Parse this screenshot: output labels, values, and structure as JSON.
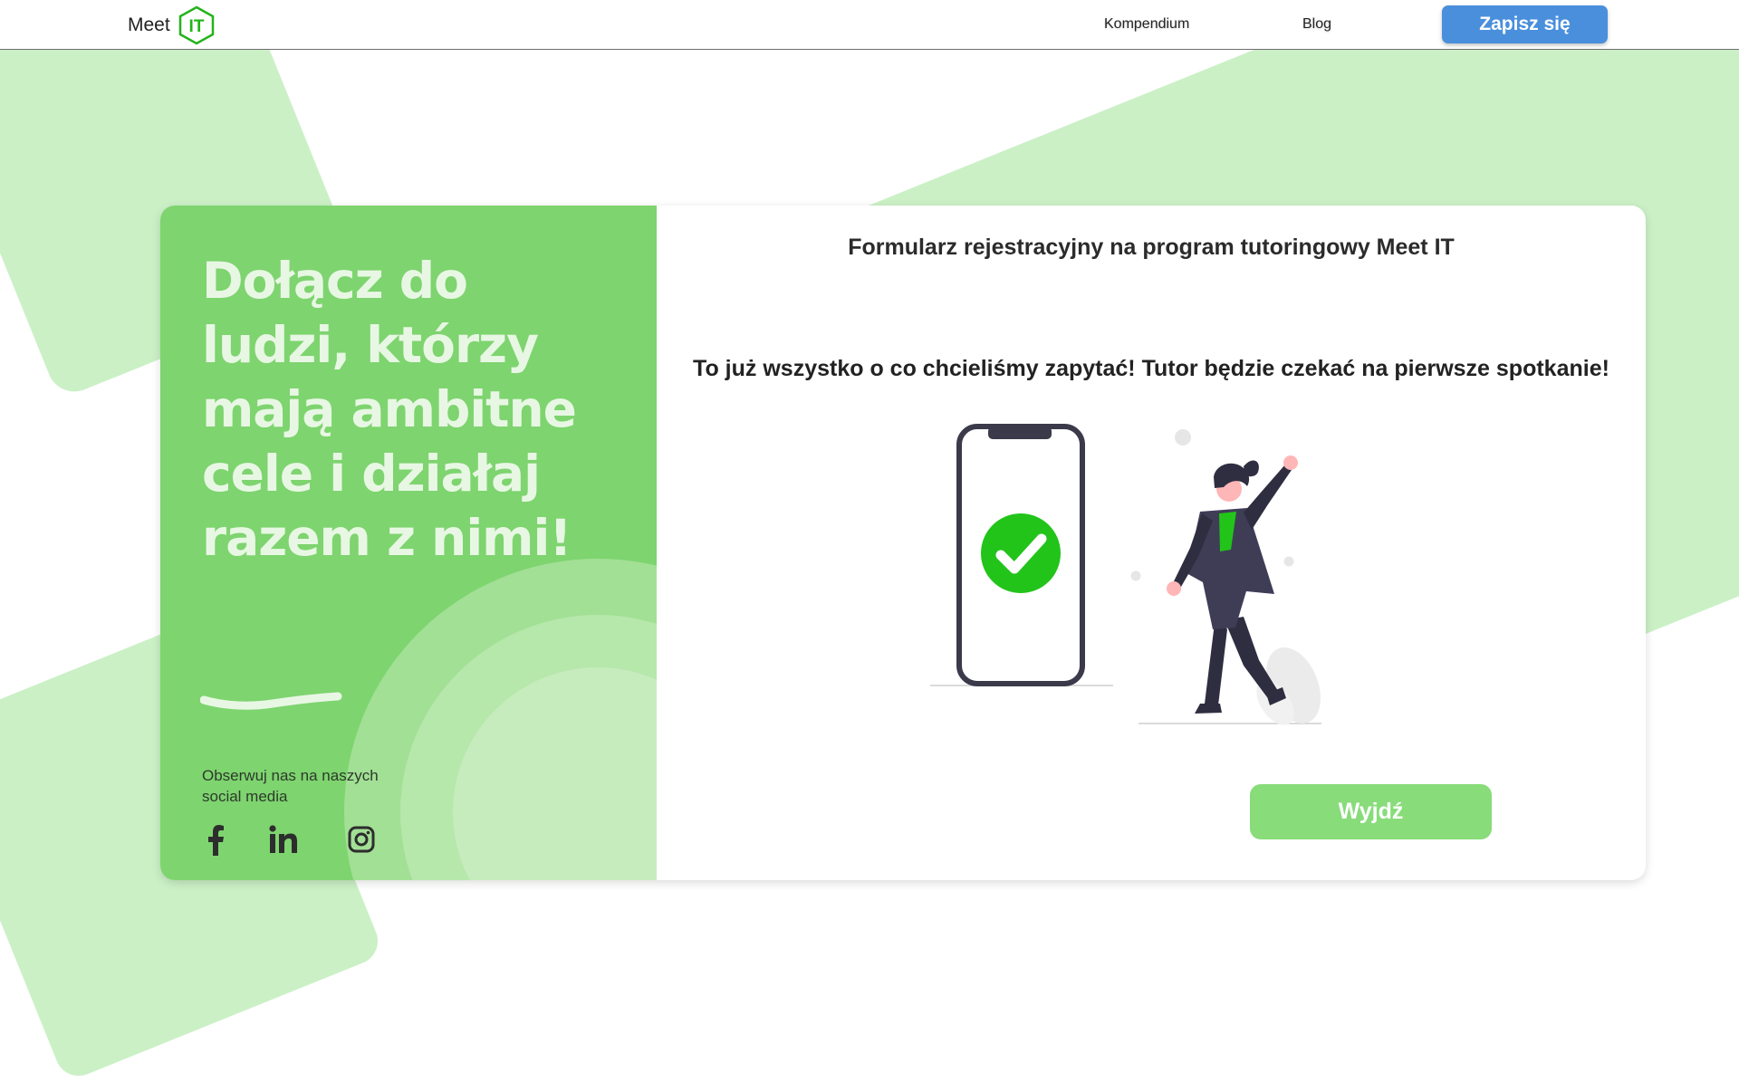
{
  "header": {
    "logo_text": "Meet",
    "logo_badge": "IT",
    "nav": {
      "kompendium": "Kompendium",
      "blog": "Blog"
    },
    "signup_label": "Zapisz się"
  },
  "left_panel": {
    "headline": "Dołącz do ludzi, którzy mają ambitne cele i działaj razem z nimi!",
    "social_text": "Obserwuj nas na naszych social media",
    "social_icons": [
      "facebook-icon",
      "linkedin-icon",
      "instagram-icon"
    ]
  },
  "form": {
    "title": "Formularz rejestracyjny na program tutoringowy Meet IT",
    "message": "To już wszystko o co chcieliśmy zapytać! Tutor będzie czekać na pierwsze spotkanie!",
    "exit_label": "Wyjdź"
  },
  "colors": {
    "brand_green": "#7ed46f",
    "light_green": "#cbf0c6",
    "button_blue": "#4a8fdc",
    "exit_green": "#88dc7a",
    "check_green": "#22c41a"
  }
}
